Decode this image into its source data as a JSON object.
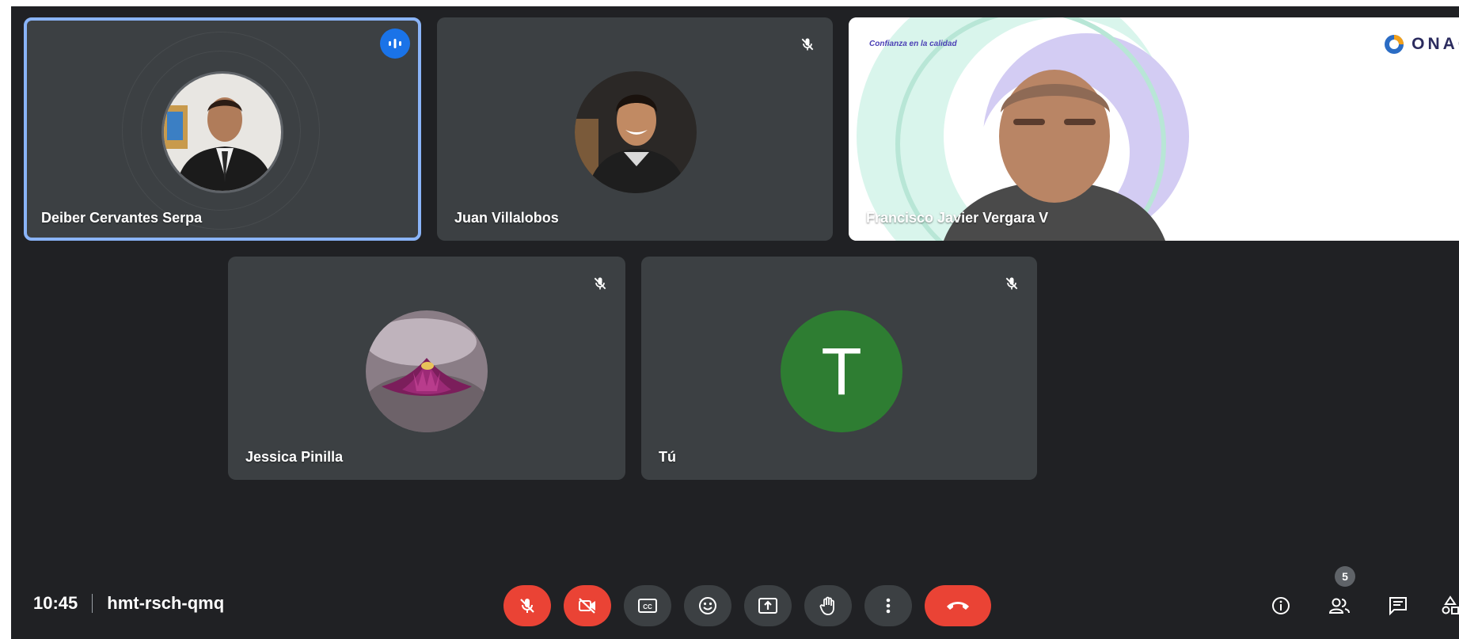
{
  "participants": [
    {
      "name": "Deiber Cervantes Serpa",
      "speaking": true
    },
    {
      "name": "Juan Villalobos",
      "muted": true
    },
    {
      "name": "Francisco Javier Vergara V",
      "presenting": true
    },
    {
      "name": "Jessica Pinilla",
      "muted": true
    },
    {
      "name": "Tú",
      "muted": true,
      "initial": "T",
      "avatar_color": "#2e7d32"
    }
  ],
  "presentation": {
    "tagline": "Confianza en la calidad",
    "logo_text": "ONAC"
  },
  "meeting": {
    "time": "10:45",
    "code": "hmt-rsch-qmq"
  },
  "controls": {
    "center": [
      {
        "icon": "mic-off-icon",
        "state": "off"
      },
      {
        "icon": "camera-off-icon",
        "state": "off"
      },
      {
        "icon": "captions-icon"
      },
      {
        "icon": "emoji-icon"
      },
      {
        "icon": "present-screen-icon"
      },
      {
        "icon": "raise-hand-icon"
      },
      {
        "icon": "more-options-icon"
      },
      {
        "icon": "end-call-icon"
      }
    ],
    "right": [
      {
        "icon": "meeting-info-icon"
      },
      {
        "icon": "people-icon",
        "badge": "5"
      },
      {
        "icon": "chat-icon"
      },
      {
        "icon": "activities-icon"
      }
    ]
  },
  "colors": {
    "background": "#202124",
    "tile": "#3c4043",
    "speaking_outline": "#8ab4f8",
    "accent_blue": "#1a73e8",
    "danger_red": "#ea4335"
  }
}
